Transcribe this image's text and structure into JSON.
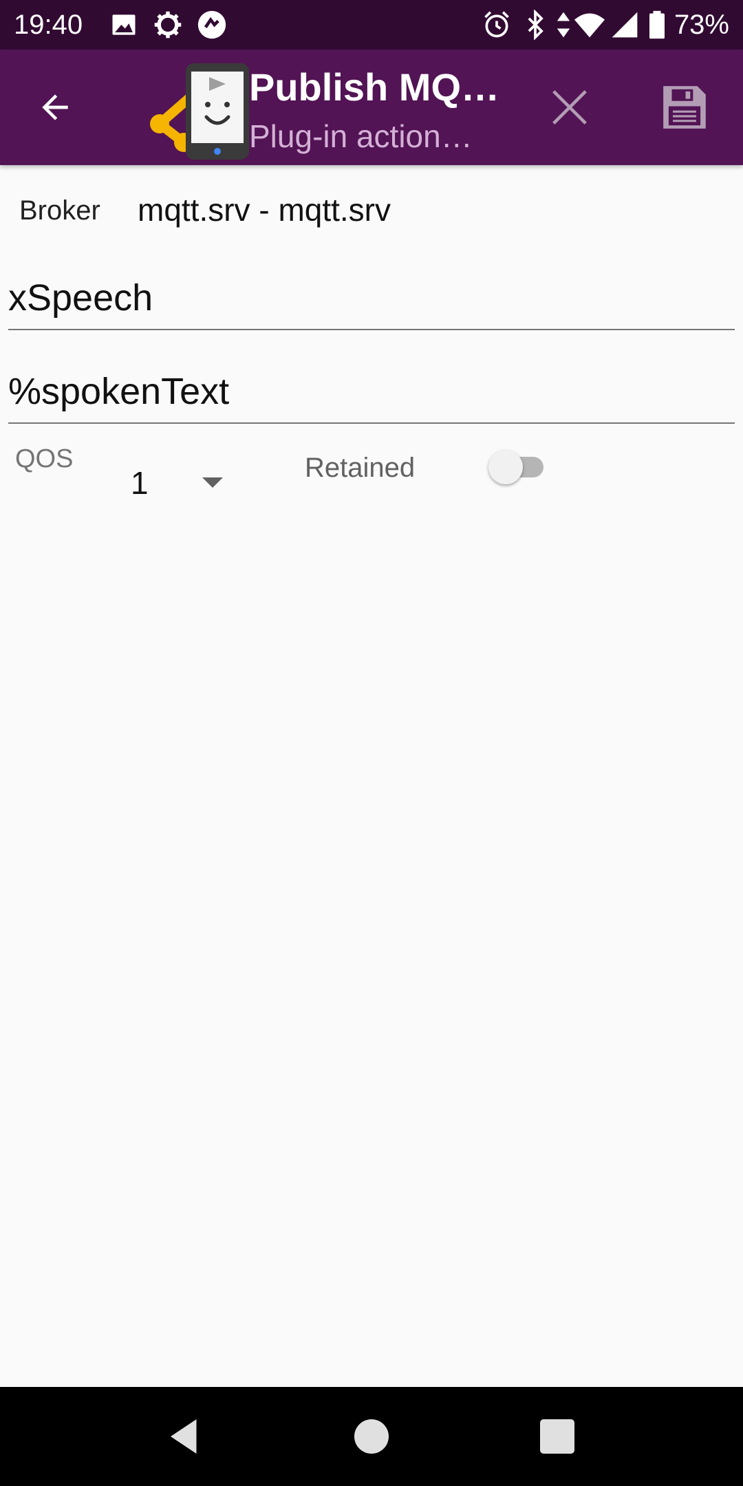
{
  "status_bar": {
    "time": "19:40",
    "battery_percent": "73%",
    "left_icons": [
      "image-icon",
      "settings-icon",
      "app-notification-icon"
    ],
    "right_icons": [
      "alarm-icon",
      "bluetooth-icon",
      "data-arrows-icon",
      "wifi-icon",
      "signal-icon",
      "battery-icon"
    ]
  },
  "app_bar": {
    "title": "Publish MQ…",
    "subtitle": "Plug-in action…",
    "back_icon": "arrow-back-icon",
    "close_icon": "close-icon",
    "save_icon": "save-icon"
  },
  "form": {
    "broker_label": "Broker",
    "broker_value": "mqtt.srv - mqtt.srv",
    "topic_value": "xSpeech",
    "payload_value": "%spokenText",
    "qos_label": "QOS",
    "qos_value": "1",
    "retained_label": "Retained",
    "retained": false
  },
  "nav_bar": {
    "icons": [
      "back-triangle-icon",
      "home-circle-icon",
      "recents-square-icon"
    ]
  },
  "colors": {
    "status_bar": "#310a32",
    "app_bar": "#521454",
    "subtitle": "#d4b0d6",
    "background": "#fafafa",
    "accent_orange": "#f4b400"
  }
}
